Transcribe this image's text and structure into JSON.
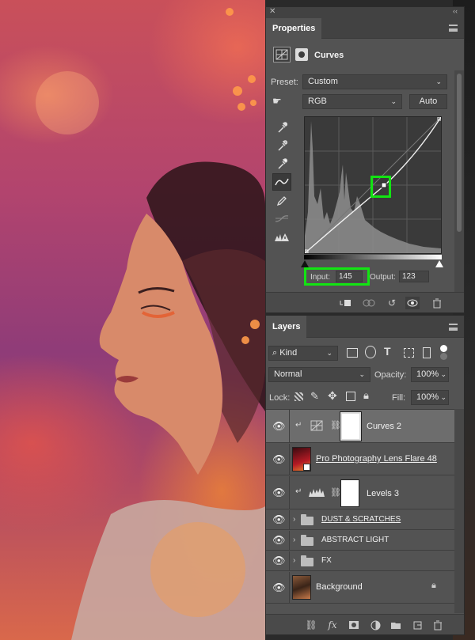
{
  "properties": {
    "tab_title": "Properties",
    "adjustment_name": "Curves",
    "preset_label": "Preset:",
    "preset_value": "Custom",
    "channel_value": "RGB",
    "auto_label": "Auto",
    "input_label": "Input:",
    "input_value": "145",
    "output_label": "Output:",
    "output_value": "123"
  },
  "layers": {
    "tab_title": "Layers",
    "filter_kind": "Kind",
    "blend_mode": "Normal",
    "opacity_label": "Opacity:",
    "opacity_value": "100%",
    "lock_label": "Lock:",
    "fill_label": "Fill:",
    "fill_value": "100%",
    "items": [
      {
        "name": "Curves 2"
      },
      {
        "name": "Pro Photography Lens Flare 48"
      },
      {
        "name": "Levels 3"
      },
      {
        "name": "DUST & SCRATCHES"
      },
      {
        "name": "ABSTRACT LIGHT"
      },
      {
        "name": "FX"
      },
      {
        "name": "Background"
      }
    ]
  },
  "colors": {
    "highlight": "#12e412",
    "panel_bg": "#535353",
    "panel_header": "#424242",
    "selected_row": "#6d6d6d"
  },
  "icons": {
    "close": "close-icon",
    "collapse": "double-chevron-icon",
    "menu": "panel-menu-icon",
    "visibility": "eye-icon",
    "lock": "lock-icon"
  }
}
